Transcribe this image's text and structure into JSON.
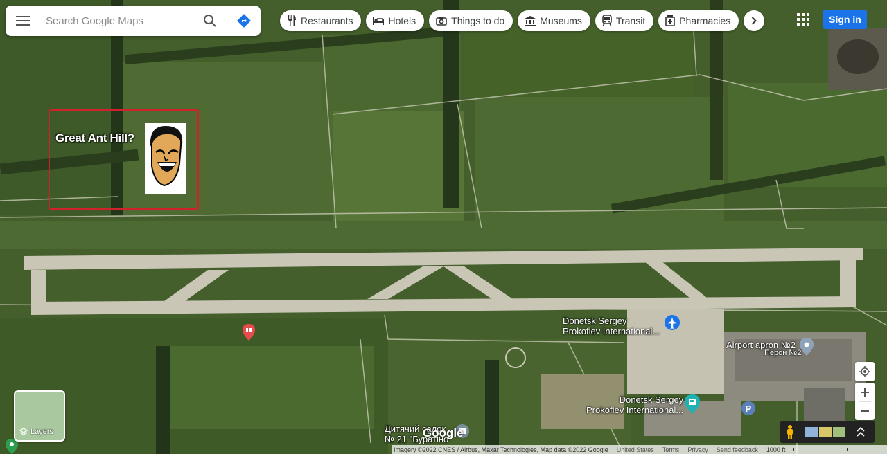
{
  "search": {
    "placeholder": "Search Google Maps"
  },
  "chips": [
    {
      "label": "Restaurants",
      "icon": "fork-knife-icon"
    },
    {
      "label": "Hotels",
      "icon": "bed-icon"
    },
    {
      "label": "Things to do",
      "icon": "camera-icon"
    },
    {
      "label": "Museums",
      "icon": "museum-icon"
    },
    {
      "label": "Transit",
      "icon": "train-icon"
    },
    {
      "label": "Pharmacies",
      "icon": "pharmacy-icon"
    }
  ],
  "header": {
    "signin_label": "Sign in"
  },
  "annotation": {
    "text": "Great Ant Hill?"
  },
  "places": {
    "airport_name": "Donetsk Sergey\nProkofiev International...",
    "apron_name": "Airport apron №2",
    "apron_sub": "Перон №2",
    "terminal_name": "Donetsk Sergey\nProkofiev International...",
    "kindergarten_name": "Дитячий садок\n№ 21 \"Буратіно\""
  },
  "layers": {
    "label": "Layers"
  },
  "footer": {
    "imagery": "Imagery ©2022 CNES / Airbus, Maxar Technologies, Map data ©2022 Google",
    "country": "United States",
    "terms": "Terms",
    "privacy": "Privacy",
    "feedback": "Send feedback",
    "scale": "1000 ft"
  },
  "logo": "Google",
  "colors": {
    "accent": "#1a73e8",
    "annotation_border": "#d1222b"
  }
}
